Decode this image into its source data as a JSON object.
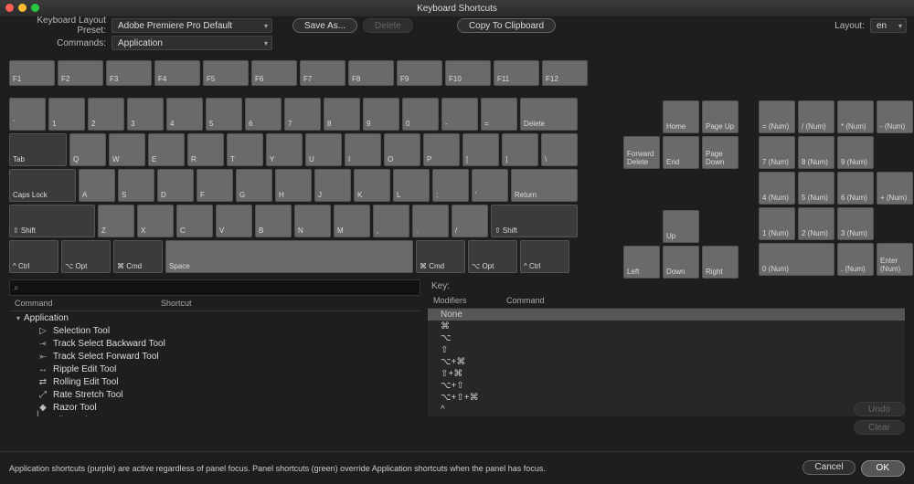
{
  "window": {
    "title": "Keyboard Shortcuts"
  },
  "toolbar": {
    "preset_label": "Keyboard Layout Preset:",
    "preset_value": "Adobe Premiere Pro Default",
    "commands_label": "Commands:",
    "commands_value": "Application",
    "save_as": "Save As...",
    "delete": "Delete",
    "copy": "Copy To Clipboard",
    "layout_label": "Layout:",
    "layout_value": "en"
  },
  "keyboard": {
    "frow": [
      "F1",
      "F2",
      "F3",
      "F4",
      "F5",
      "F6",
      "F7",
      "F8",
      "F9",
      "F10",
      "F11",
      "F12"
    ],
    "row1": [
      "`",
      "1",
      "2",
      "3",
      "4",
      "5",
      "6",
      "7",
      "8",
      "9",
      "0",
      "-",
      "=",
      "Delete"
    ],
    "row2": [
      "Tab",
      "Q",
      "W",
      "E",
      "R",
      "T",
      "Y",
      "U",
      "I",
      "O",
      "P",
      "[",
      "]",
      "\\"
    ],
    "row3": [
      "Caps Lock",
      "A",
      "S",
      "D",
      "F",
      "G",
      "H",
      "J",
      "K",
      "L",
      ";",
      "'",
      "Return"
    ],
    "row4": [
      "⇧ Shift",
      "Z",
      "X",
      "C",
      "V",
      "B",
      "N",
      "M",
      ",",
      ".",
      "/",
      "⇧ Shift"
    ],
    "row5": [
      "^ Ctrl",
      "⌥ Opt",
      "⌘ Cmd",
      "Space",
      "⌘ Cmd",
      "⌥ Opt",
      "^ Ctrl"
    ],
    "nav1": [
      "Home",
      "Page Up"
    ],
    "nav2": [
      "Forward\nDelete",
      "End",
      "Page\nDown"
    ],
    "nav3": [
      "Up"
    ],
    "nav4": [
      "Left",
      "Down",
      "Right"
    ],
    "num": [
      [
        "= (Num)",
        "/ (Num)",
        "* (Num)",
        "- (Num)"
      ],
      [
        "7 (Num)",
        "8 (Num)",
        "9 (Num)",
        ""
      ],
      [
        "4 (Num)",
        "5 (Num)",
        "6 (Num)",
        "+ (Num)"
      ],
      [
        "1 (Num)",
        "2 (Num)",
        "3 (Num)",
        ""
      ],
      [
        "0 (Num)",
        "",
        ". (Num)",
        "Enter\n(Num)"
      ]
    ]
  },
  "left": {
    "search_placeholder": "",
    "col_command": "Command",
    "col_shortcut": "Shortcut",
    "root": "Application",
    "items": [
      {
        "icon": "▷",
        "label": "Selection Tool"
      },
      {
        "icon": "⤛",
        "label": "Track Select Backward Tool"
      },
      {
        "icon": "⤜",
        "label": "Track Select Forward Tool"
      },
      {
        "icon": "↔",
        "label": "Ripple Edit Tool"
      },
      {
        "icon": "⇄",
        "label": "Rolling Edit Tool"
      },
      {
        "icon": "⤢",
        "label": "Rate Stretch Tool"
      },
      {
        "icon": "◆",
        "label": "Razor Tool"
      },
      {
        "icon": "|↔|",
        "label": "Slip Tool"
      }
    ]
  },
  "right": {
    "key_label": "Key:",
    "col_mod": "Modifiers",
    "col_cmd": "Command",
    "rows": [
      "None",
      "⌘",
      "⌥",
      "⇧",
      "⌥+⌘",
      "⇧+⌘",
      "⌥+⇧",
      "⌥+⇧+⌘",
      "^"
    ]
  },
  "side": {
    "undo": "Undo",
    "clear": "Clear"
  },
  "footer": {
    "msg": "Application shortcuts (purple) are active regardless of panel focus. Panel shortcuts (green) override Application shortcuts when the panel has focus.",
    "cancel": "Cancel",
    "ok": "OK"
  }
}
